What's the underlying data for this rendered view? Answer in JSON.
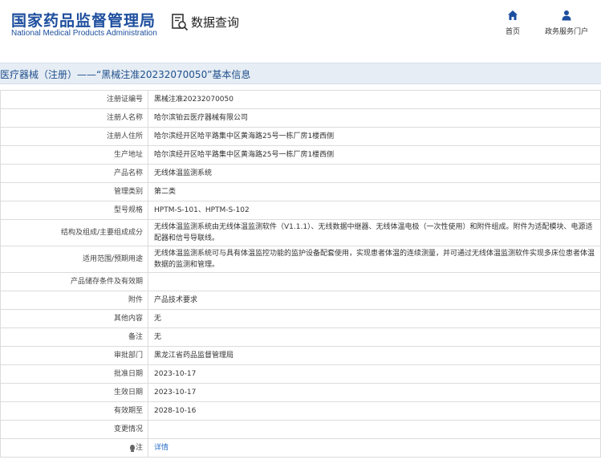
{
  "header": {
    "logo_zh": "国家药品监督管理局",
    "logo_en": "National Medical Products Administration",
    "query_title": "数据查询",
    "nav": [
      {
        "label": "首页",
        "icon": "home-icon"
      },
      {
        "label": "政务服务门户",
        "icon": "user-icon"
      }
    ],
    "brand_color": "#1d4e9e"
  },
  "title": "内医疗器械（注册）——“黑械注准20232070050”基本信息",
  "rows": [
    {
      "label": "注册证编号",
      "value": "黑械注准20232070050"
    },
    {
      "label": "注册人名称",
      "value": "哈尔滨铂云医疗器械有限公司"
    },
    {
      "label": "注册人住所",
      "value": "哈尔滨经开区哈平路集中区黄海路25号一栋厂房1楼西侧"
    },
    {
      "label": "生产地址",
      "value": "哈尔滨经开区哈平路集中区黄海路25号一栋厂房1楼西侧"
    },
    {
      "label": "产品名称",
      "value": "无线体温监测系统"
    },
    {
      "label": "管理类别",
      "value": "第二类"
    },
    {
      "label": "型号规格",
      "value": "HPTM-S-101、HPTM-S-102"
    },
    {
      "label": "结构及组成/主要组成成分",
      "value": "无线体温监测系统由无线体温监测软件（V1.1.1）、无线数据中继器、无线体温电极（一次性使用）和附件组成。附件为适配模块、电源适配器和信号导联线。"
    },
    {
      "label": "适用范围/预期用途",
      "value": "无线体温监测系统可与具有体温监控功能的监护设备配套使用，实现患者体温的连续测量，并可通过无线体温监测软件实现多床位患者体温数据的监测和管理。"
    },
    {
      "label": "产品储存条件及有效期",
      "value": ""
    },
    {
      "label": "附件",
      "value": "产品技术要求"
    },
    {
      "label": "其他内容",
      "value": "无"
    },
    {
      "label": "备注",
      "value": "无"
    },
    {
      "label": "审批部门",
      "value": "黑龙江省药品监督管理局"
    },
    {
      "label": "批准日期",
      "value": "2023-10-17"
    },
    {
      "label": "生效日期",
      "value": "2023-10-17"
    },
    {
      "label": "有效期至",
      "value": "2028-10-16"
    },
    {
      "label": "变更情况",
      "value": ""
    }
  ],
  "note_row": {
    "label": "注",
    "link": "详情",
    "icon": "lightbulb-icon"
  }
}
